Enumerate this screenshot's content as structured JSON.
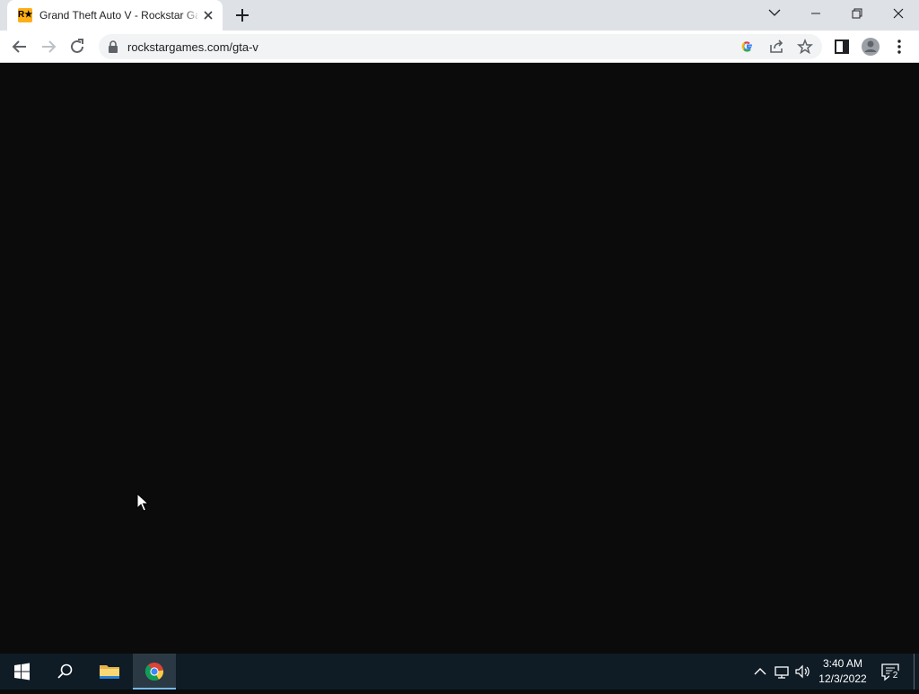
{
  "browser": {
    "tab": {
      "title": "Grand Theft Auto V - Rockstar Games",
      "favicon_text": "R★",
      "favicon_color": "#fcaf17"
    },
    "address_bar": {
      "url": "rockstargames.com/gta-v"
    }
  },
  "taskbar": {
    "clock": {
      "time": "3:40 AM",
      "date": "12/3/2022"
    },
    "notification_count": "2"
  },
  "colors": {
    "page_background": "#0b0b0b",
    "taskbar": "#0f1c26",
    "accent": "#76b9ed"
  }
}
